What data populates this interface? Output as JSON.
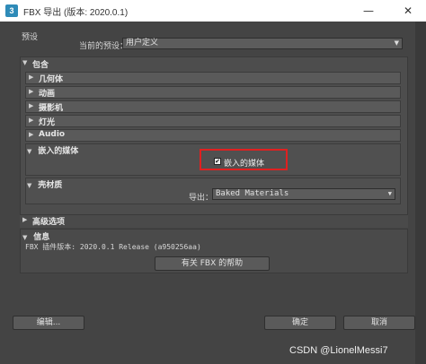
{
  "window": {
    "title": "FBX 导出 (版本: 2020.0.1)",
    "app_icon": "3",
    "min_glyph": "—",
    "close_glyph": "✕"
  },
  "presets": {
    "group_label": "预设",
    "current_label": "当前的预设：",
    "current_value": "用户定义"
  },
  "include": {
    "header": "包含",
    "items": [
      {
        "label": "几何体"
      },
      {
        "label": "动画"
      },
      {
        "label": "摄影机"
      },
      {
        "label": "灯光"
      },
      {
        "label": "Audio"
      }
    ],
    "embed_media": {
      "header": "嵌入的媒体",
      "checkbox_label": "嵌入的媒体",
      "checked": true
    },
    "materials": {
      "header": "壳材质",
      "export_label": "导出：",
      "export_value": "Baked Materials"
    }
  },
  "advanced": {
    "header": "高级选项"
  },
  "info": {
    "header": "信息",
    "plugin_version": "FBX 插件版本: 2020.0.1 Release (a950256aa)",
    "help_button": "有关 FBX 的帮助"
  },
  "footer": {
    "edit_button": "编辑...",
    "ok_button": "确定",
    "cancel_button": "取消"
  },
  "watermark": "CSDN @LionelMessi7"
}
